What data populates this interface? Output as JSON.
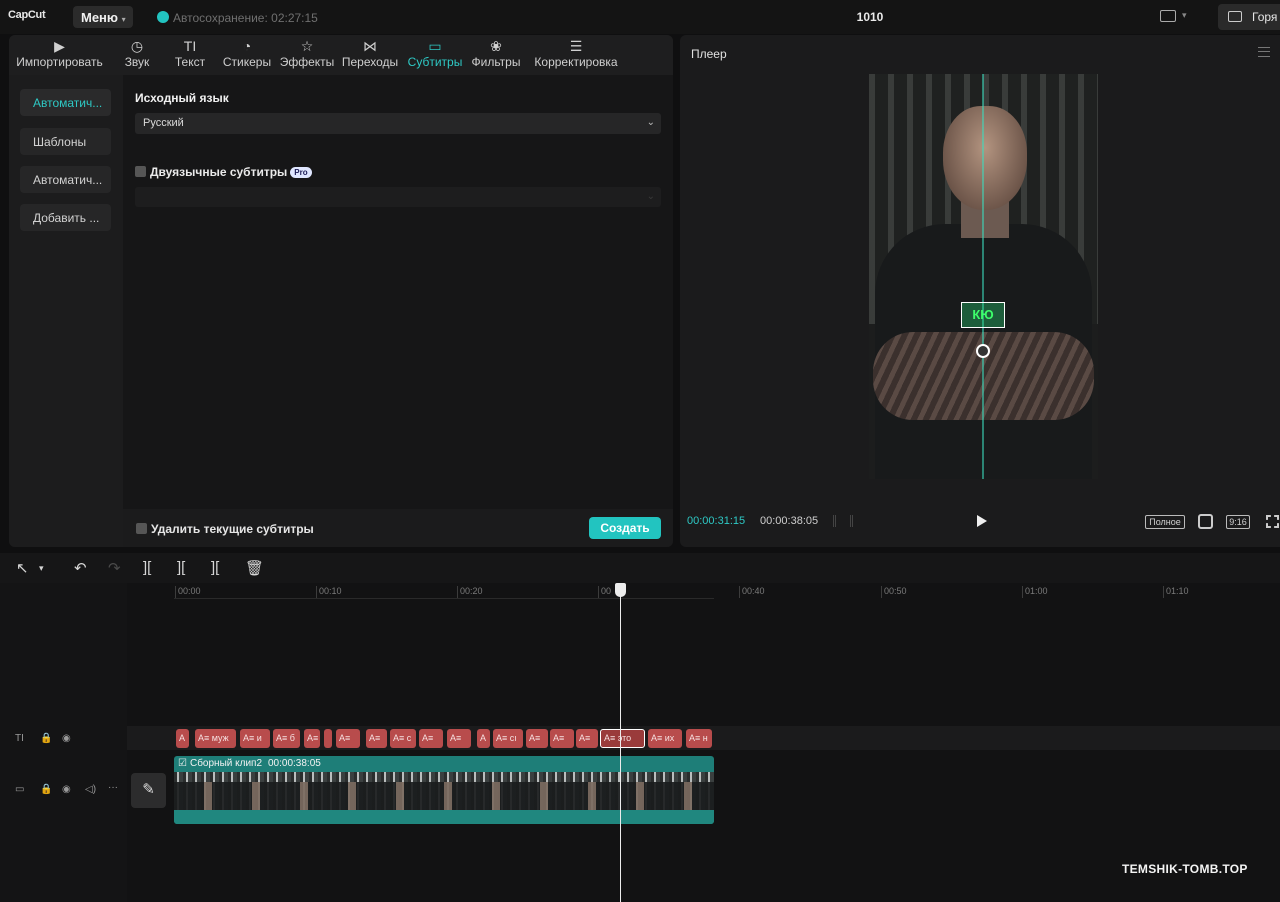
{
  "app": {
    "logo": "CapCut",
    "menu_label": "Меню",
    "autosave": "Автосохранение: 02:27:15",
    "project_title": "1010",
    "shortcut_label": "Горя"
  },
  "tabs": [
    {
      "icon": "import-icon",
      "label": "Импортировать"
    },
    {
      "icon": "audio-icon",
      "label": "Звук"
    },
    {
      "icon": "text-icon",
      "label": "Текст"
    },
    {
      "icon": "sticker-icon",
      "label": "Стикеры"
    },
    {
      "icon": "effects-icon",
      "label": "Эффекты"
    },
    {
      "icon": "transitions-icon",
      "label": "Переходы"
    },
    {
      "icon": "subtitles-icon",
      "label": "Субтитры",
      "active": true
    },
    {
      "icon": "filters-icon",
      "label": "Фильтры"
    },
    {
      "icon": "adjust-icon",
      "label": "Корректировка"
    }
  ],
  "sidebar": {
    "items": [
      {
        "label": "Автоматич...",
        "active": true
      },
      {
        "label": "Шаблоны"
      },
      {
        "label": "Автоматич..."
      },
      {
        "label": "Добавить ..."
      }
    ]
  },
  "captions": {
    "source_language_label": "Исходный язык",
    "source_language_value": "Русский",
    "bilingual_label": "Двуязычные субтитры",
    "pro_badge": "Pro",
    "delete_existing_label": "Удалить текущие субтитры",
    "create_label": "Создать"
  },
  "player": {
    "title": "Плеер",
    "subtitle_text": "КЮ",
    "time_current": "00:00:31:15",
    "time_total": "00:00:38:05",
    "full_label": "Полное",
    "ratio_label": "9:16"
  },
  "timeline": {
    "ruler": [
      "00:00",
      "00:10",
      "00:20",
      "00",
      "00:40",
      "00:50",
      "01:00",
      "01:10"
    ],
    "subtitle_clips": [
      "A",
      "A≡ муж",
      "A≡ и",
      "A≡ б",
      "A≡",
      "",
      "A≡",
      "A≡",
      "A≡ с",
      "A≡",
      "A≡",
      "A",
      "A≡ сı",
      "A≡",
      "A≡",
      "A≡",
      "A≡ это",
      "A≡ их",
      "A≡ н"
    ],
    "selected_clip_index": 16,
    "video_clip_name": "Сборный клип2",
    "video_clip_duration": "00:00:38:05"
  },
  "watermark": "TEMSHIK-TOMB.TOP",
  "colors": {
    "accent": "#22c4c0",
    "subtitle_clip": "#b84c4c",
    "video_clip": "#1e7e78"
  }
}
